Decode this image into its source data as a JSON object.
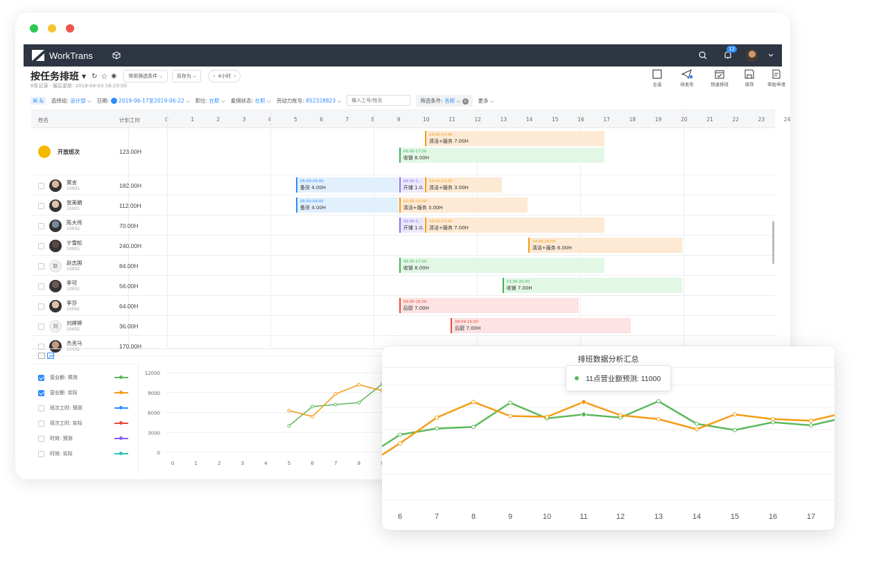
{
  "window_controls": {
    "colors": [
      "#2cc84d",
      "#f7c331",
      "#f0564a"
    ]
  },
  "navbar": {
    "brand": "WorkTrans",
    "notification_count": "12",
    "icons": [
      "cube-icon",
      "search-icon",
      "bell-icon",
      "avatar",
      "chevron-down-icon"
    ]
  },
  "header": {
    "title": "按任务排班",
    "subtitle": "8条记录 · 最后更新: 2018-04-03 16:23:00",
    "preset_select": "常用筛选条件",
    "save_as": "另存为",
    "time_step": "4小时",
    "toolbar": [
      {
        "label": "全选",
        "icon": "checkbox-icon"
      },
      {
        "label": "待发布",
        "icon": "paper-plane-icon"
      },
      {
        "label": "快速排班",
        "icon": "calendar-icon"
      },
      {
        "label": "保存",
        "icon": "floppy-icon"
      },
      {
        "label": "审批申请",
        "icon": "document-icon"
      }
    ]
  },
  "filters": {
    "group_label": "选择组:",
    "group_value": "设计部",
    "date_label": "日期:",
    "date_value": "2019-06-17至2019-06-22",
    "position_label": "职位:",
    "position_value": "在职",
    "employ_label": "雇佣状态:",
    "employ_value": "在职",
    "account_label": "劳动力账号:",
    "account_value": "852328823",
    "search_placeholder": "输入工号/姓名",
    "condition_label": "筛选条件:",
    "condition_value": "名称",
    "more": "更多"
  },
  "grid": {
    "col_name": "姓名",
    "col_hours": "计划工时",
    "hour_ticks": [
      "0",
      "1",
      "2",
      "3",
      "4",
      "5",
      "6",
      "7",
      "8",
      "9",
      "10",
      "11",
      "12",
      "13",
      "14",
      "15",
      "16",
      "17",
      "18",
      "19",
      "20",
      "21",
      "22",
      "23",
      "24"
    ],
    "rows": [
      {
        "name": "开放班次",
        "id": "",
        "hours": "123.00H",
        "avatar": "open",
        "shifts": [
          {
            "time": "10:00-17:00",
            "label": "清洁+服务 7.00H",
            "start": 10,
            "end": 17,
            "lane": 0,
            "type": "orange"
          },
          {
            "time": "09:00-17:00",
            "label": "收银 8.00H",
            "start": 9,
            "end": 17,
            "lane": 1,
            "type": "green"
          }
        ]
      },
      {
        "name": "莫言",
        "id": "10001",
        "hours": "182.00H",
        "avatar": "photo",
        "shifts": [
          {
            "time": "05:00-09:00",
            "label": "备货 4.00H",
            "start": 5,
            "end": 9,
            "lane": 0,
            "type": "blue"
          },
          {
            "time": "09:00-1...",
            "label": "开铺 1.0...",
            "start": 9,
            "end": 10,
            "lane": 0,
            "type": "purple"
          },
          {
            "time": "10:00-13:00",
            "label": "清洁+服务 3.00H",
            "start": 10,
            "end": 13,
            "lane": 0,
            "type": "orange"
          }
        ]
      },
      {
        "name": "张美娟",
        "id": "10001",
        "hours": "112.00H",
        "avatar": "photo",
        "shifts": [
          {
            "time": "05:00-09:00",
            "label": "备货 4.00H",
            "start": 5,
            "end": 9,
            "lane": 0,
            "type": "blue"
          },
          {
            "time": "10:00-13:00",
            "label": "清洁+服务 3.00H",
            "start": 9,
            "end": 14,
            "lane": 0,
            "type": "orange"
          }
        ]
      },
      {
        "name": "陈大伟",
        "id": "10002",
        "hours": "70.00H",
        "avatar": "photo",
        "shifts": [
          {
            "time": "09:00-1...",
            "label": "开铺 1.0...",
            "start": 9,
            "end": 10,
            "lane": 0,
            "type": "purple"
          },
          {
            "time": "10:00-17:00",
            "label": "清洁+服务 7.00H",
            "start": 10,
            "end": 17,
            "lane": 0,
            "type": "orange"
          }
        ]
      },
      {
        "name": "宁雪松",
        "id": "10001",
        "hours": "240.00H",
        "avatar": "photo",
        "shifts": [
          {
            "time": "14:00-20:00",
            "label": "清洁+服务 6.00H",
            "start": 14,
            "end": 20,
            "lane": 0,
            "type": "orange"
          }
        ]
      },
      {
        "name": "赵志国",
        "id": "10002",
        "hours": "84.00H",
        "avatar": "赵",
        "shifts": [
          {
            "time": "09:00-17:00",
            "label": "收银 8.00H",
            "start": 9,
            "end": 17,
            "lane": 0,
            "type": "green"
          }
        ]
      },
      {
        "name": "李可",
        "id": "10002",
        "hours": "56.00H",
        "avatar": "photo",
        "shifts": [
          {
            "time": "13:00-20:00",
            "label": "收银 7.00H",
            "start": 13,
            "end": 20,
            "lane": 0,
            "type": "green"
          }
        ]
      },
      {
        "name": "李莎",
        "id": "10002",
        "hours": "64.00H",
        "avatar": "photo",
        "shifts": [
          {
            "time": "09:00-16:00",
            "label": "后厨 7.00H",
            "start": 9,
            "end": 16,
            "lane": 0,
            "type": "red"
          }
        ]
      },
      {
        "name": "刘婷婷",
        "id": "10002",
        "hours": "36.00H",
        "avatar": "刘",
        "shifts": [
          {
            "time": "09:09-16:00",
            "label": "后厨 7.00H",
            "start": 11,
            "end": 18,
            "lane": 0,
            "type": "red"
          }
        ]
      },
      {
        "name": "杰克马",
        "id": "10002",
        "hours": "170.00H",
        "avatar": "photo",
        "shifts": []
      }
    ]
  },
  "legend": [
    {
      "label": "营业额: 预测",
      "checked": true,
      "color": "#5cb85c"
    },
    {
      "label": "营业额: 实际",
      "checked": true,
      "color": "#f39c12"
    },
    {
      "label": "班次工时: 预测",
      "checked": false,
      "color": "#2f8cff"
    },
    {
      "label": "班次工时: 实际",
      "checked": false,
      "color": "#e74c3c"
    },
    {
      "label": "时效: 预测",
      "checked": false,
      "color": "#8e5cf0"
    },
    {
      "label": "时效: 实际",
      "checked": false,
      "color": "#2ec4b6"
    }
  ],
  "chart_data": [
    {
      "type": "line",
      "y_ticks": [
        "12000",
        "9000",
        "6000",
        "3000",
        "0"
      ],
      "ylim": [
        0,
        12000
      ],
      "categories": [
        "0",
        "1",
        "2",
        "3",
        "4",
        "5",
        "6",
        "7",
        "8",
        "9"
      ],
      "series": [
        {
          "name": "营业额: 预测",
          "color": "#5cb85c",
          "values": [
            null,
            null,
            null,
            null,
            null,
            4000,
            6900,
            7200,
            7500,
            10300
          ]
        },
        {
          "name": "营业额: 实际",
          "color": "#f39c12",
          "values": [
            null,
            null,
            null,
            null,
            null,
            6300,
            5400,
            8800,
            10200,
            9300
          ]
        }
      ]
    },
    {
      "type": "line",
      "title": "排班数据分析汇总",
      "categories": [
        "6",
        "7",
        "8",
        "9",
        "10",
        "11",
        "12",
        "13",
        "14",
        "15",
        "16",
        "17"
      ],
      "ylim": [
        0,
        16000
      ],
      "grid": true,
      "series": [
        {
          "name": "营业额预测",
          "color": "#5cb85c",
          "values": [
            8400,
            9200,
            9400,
            12500,
            10500,
            11000,
            10600,
            12700,
            9800,
            9000,
            10000,
            9600
          ]
        },
        {
          "name": "营业额实际",
          "color": "#f39c12",
          "values": [
            7300,
            10600,
            12600,
            10800,
            10700,
            12600,
            10900,
            10400,
            9100,
            11000,
            10400,
            10200
          ]
        }
      ],
      "tooltip": "11点营业额预测: 11000"
    }
  ]
}
